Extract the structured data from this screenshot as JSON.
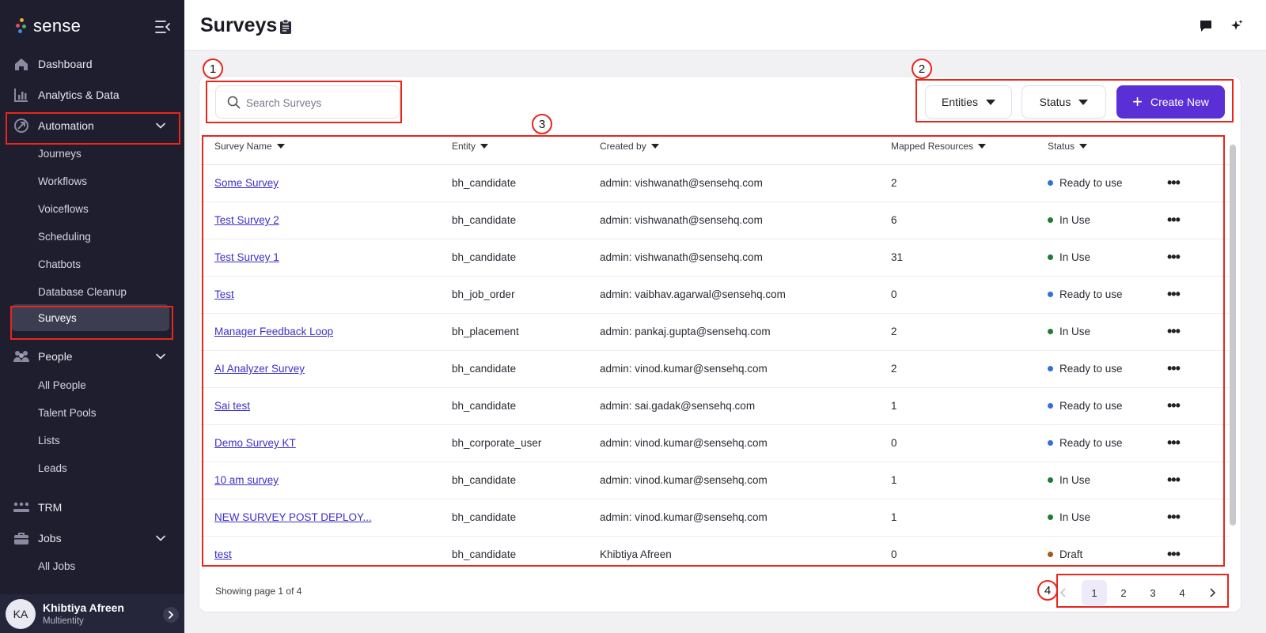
{
  "brand": {
    "name": "sense",
    "dot_colors": [
      "#f2a93b",
      "#e64a5e",
      "#4cb36b",
      "#3a8ee6"
    ]
  },
  "sidebar": {
    "items": [
      {
        "label": "Dashboard",
        "icon": "home-icon"
      },
      {
        "label": "Analytics & Data",
        "icon": "bar-chart-icon"
      },
      {
        "label": "Automation",
        "icon": "automation-icon",
        "expanded": true,
        "children": [
          "Journeys",
          "Workflows",
          "Voiceflows",
          "Scheduling",
          "Chatbots",
          "Database Cleanup",
          "Surveys"
        ]
      },
      {
        "label": "People",
        "icon": "people-icon",
        "expanded": true,
        "children": [
          "All People",
          "Talent Pools",
          "Lists",
          "Leads"
        ]
      },
      {
        "label": "TRM",
        "icon": "trm-icon"
      },
      {
        "label": "Jobs",
        "icon": "briefcase-icon",
        "expanded": true,
        "children": [
          "All Jobs"
        ]
      }
    ],
    "active": "Surveys",
    "user": {
      "initials": "KA",
      "name": "Khibtiya Afreen",
      "subtitle": "Multientity"
    }
  },
  "header": {
    "title": "Surveys"
  },
  "toolbar": {
    "search_placeholder": "Search Surveys",
    "entities_label": "Entities",
    "status_label": "Status",
    "create_label": "Create New"
  },
  "table": {
    "columns": [
      "Survey Name",
      "Entity",
      "Created by",
      "Mapped Resources",
      "Status"
    ],
    "rows": [
      {
        "name": "Some Survey",
        "entity": "bh_candidate",
        "created_by": "admin: vishwanath@sensehq.com",
        "mapped": "2",
        "status": "Ready to use"
      },
      {
        "name": "Test Survey 2",
        "entity": "bh_candidate",
        "created_by": "admin: vishwanath@sensehq.com",
        "mapped": "6",
        "status": "In Use"
      },
      {
        "name": "Test Survey 1",
        "entity": "bh_candidate",
        "created_by": "admin: vishwanath@sensehq.com",
        "mapped": "31",
        "status": "In Use"
      },
      {
        "name": "Test",
        "entity": "bh_job_order",
        "created_by": "admin: vaibhav.agarwal@sensehq.com",
        "mapped": "0",
        "status": "Ready to use"
      },
      {
        "name": "Manager Feedback Loop",
        "entity": "bh_placement",
        "created_by": "admin: pankaj.gupta@sensehq.com",
        "mapped": "2",
        "status": "In Use"
      },
      {
        "name": "AI Analyzer Survey",
        "entity": "bh_candidate",
        "created_by": "admin: vinod.kumar@sensehq.com",
        "mapped": "2",
        "status": "Ready to use"
      },
      {
        "name": "Sai test",
        "entity": "bh_candidate",
        "created_by": "admin: sai.gadak@sensehq.com",
        "mapped": "1",
        "status": "Ready to use"
      },
      {
        "name": "Demo Survey KT",
        "entity": "bh_corporate_user",
        "created_by": "admin: vinod.kumar@sensehq.com",
        "mapped": "0",
        "status": "Ready to use"
      },
      {
        "name": "10 am survey",
        "entity": "bh_candidate",
        "created_by": "admin: vinod.kumar@sensehq.com",
        "mapped": "1",
        "status": "In Use"
      },
      {
        "name": "NEW SURVEY POST DEPLOY...",
        "entity": "bh_candidate",
        "created_by": "admin: vinod.kumar@sensehq.com",
        "mapped": "1",
        "status": "In Use"
      },
      {
        "name": "test",
        "entity": "bh_candidate",
        "created_by": "Khibtiya Afreen",
        "mapped": "0",
        "status": "Draft"
      }
    ],
    "status_colors": {
      "Ready to use": "#2f6fe0",
      "In Use": "#1f7a3a",
      "Draft": "#a5581c"
    }
  },
  "pagination": {
    "summary": "Showing page 1 of 4",
    "pages": [
      "1",
      "2",
      "3",
      "4"
    ],
    "current": "1"
  },
  "annotations": [
    "1",
    "2",
    "3",
    "4"
  ],
  "colors": {
    "sidebar_bg": "#1e1e2e",
    "accent": "#5b2fd6",
    "link": "#3d2fc9",
    "annotation": "#e8261c"
  }
}
